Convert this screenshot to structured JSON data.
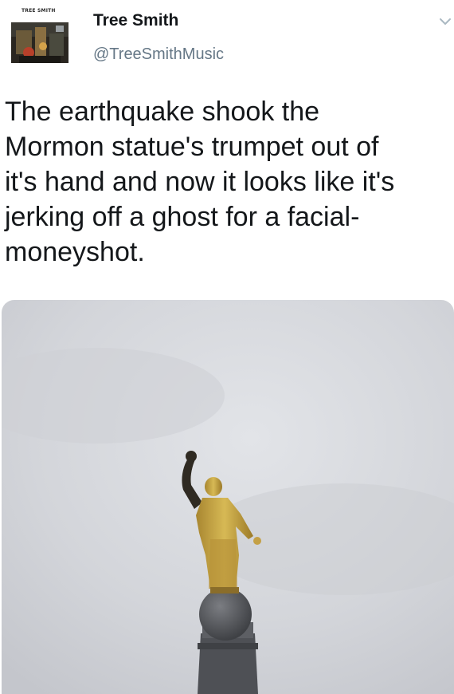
{
  "tweet": {
    "avatar": {
      "caption": "TREE SMITH",
      "icon": "profile-avatar-image"
    },
    "author": {
      "display_name": "Tree Smith",
      "handle": "@TreeSmithMusic"
    },
    "menu_icon": "chevron-down-icon",
    "text_lines": [
      "The earthquake shook the",
      "Mormon statue's trumpet out of",
      "it's hand and now it looks like it's",
      "jerking off a ghost for a facial-",
      "moneyshot."
    ],
    "media": {
      "icon": "statue-photo"
    }
  },
  "colors": {
    "text": "#14171a",
    "handle": "#657786",
    "sky": "#d6d8dd",
    "statue_gold": "#c9a844",
    "sphere": "#56585d"
  }
}
